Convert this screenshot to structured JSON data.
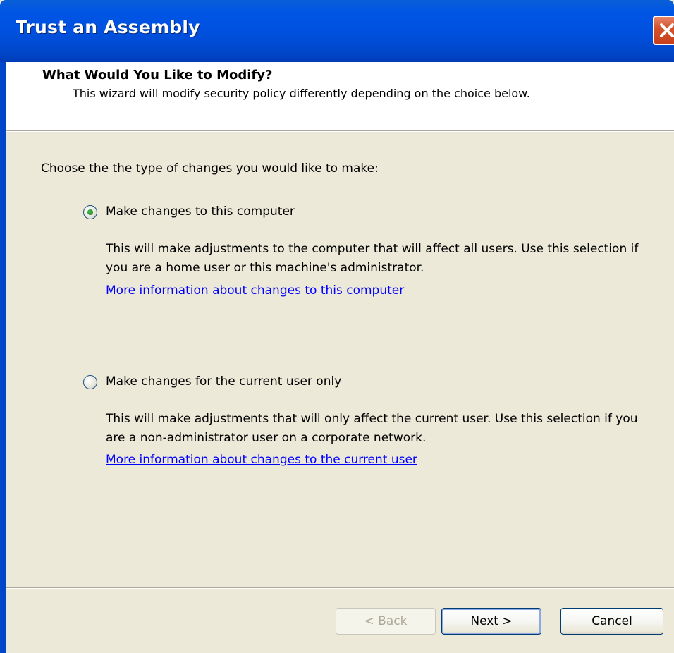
{
  "window": {
    "title": "Trust an Assembly"
  },
  "header": {
    "title": "What Would You Like to Modify?",
    "description": "This wizard will modify security policy differently depending on the choice below."
  },
  "content": {
    "prompt": "Choose the the type of changes you would like to make:",
    "options": [
      {
        "label": "Make changes to this computer",
        "selected": true,
        "description": "This will make adjustments to the computer that will affect all users.  Use this selection if you are a home user or this machine's administrator.",
        "link": "More information about changes to this computer"
      },
      {
        "label": "Make changes for the current user only",
        "selected": false,
        "description": "This will make adjustments that will only affect the current user.  Use this selection if you are a non-administrator user on a corporate network.",
        "link": "More information about changes to the current user"
      }
    ]
  },
  "buttons": {
    "back": "< Back",
    "next": "Next >",
    "cancel": "Cancel"
  },
  "colors": {
    "titlebar": "#0054e3",
    "dialog_bg": "#ece9d8",
    "link": "#0000ff"
  }
}
